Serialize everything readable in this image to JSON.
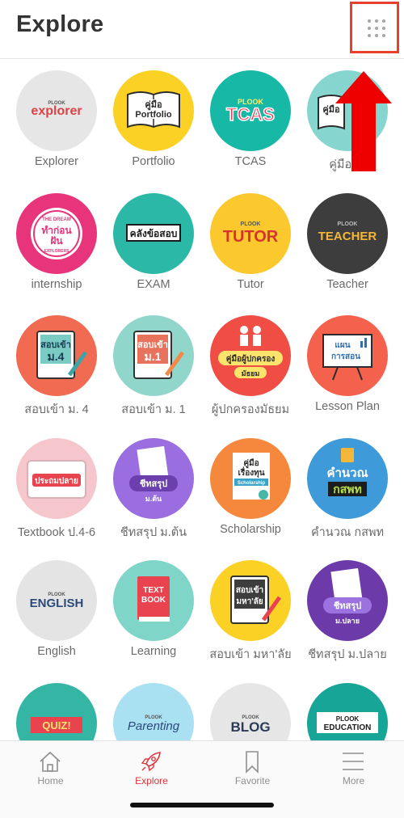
{
  "header": {
    "title": "Explore"
  },
  "items": [
    {
      "label": "Explorer",
      "color": "#e6e6e6",
      "logo": "PLOOK explorer"
    },
    {
      "label": "Portfolio",
      "color": "#fbd126",
      "logo": "คู่มือ Portfolio"
    },
    {
      "label": "TCAS",
      "color": "#17b8a6",
      "logo": "PLOOK TCAS"
    },
    {
      "label": "คู่มือ ม.",
      "color": "#86d6cf",
      "logo": "คู่มือ"
    },
    {
      "label": "internship",
      "color": "#e8347a",
      "logo": "THE DREAM ทำก่อนฝัน EXPLORERS"
    },
    {
      "label": "EXAM",
      "color": "#2bb8a6",
      "logo": "คลังข้อสอบ"
    },
    {
      "label": "Tutor",
      "color": "#fbc82e",
      "logo": "PLOOK TUTOR"
    },
    {
      "label": "Teacher",
      "color": "#3d3d3d",
      "logo": "PLOOK TEACHER"
    },
    {
      "label": "สอบเข้า ม. 4",
      "color": "#f16a52",
      "logo": "สอบเข้า ม.4"
    },
    {
      "label": "สอบเข้า ม. 1",
      "color": "#90d6cb",
      "logo": "สอบเข้า ม.1"
    },
    {
      "label": "ผู้ปกครองมัธยม",
      "color": "#f04e45",
      "logo": "คู่มือผู้ปกครอง มัธยม"
    },
    {
      "label": "Lesson Plan",
      "color": "#f4624e",
      "logo": "แผนการสอน"
    },
    {
      "label": "Textbook ป.4-6",
      "color": "#f5c7cc",
      "logo": "ประถมปลาย"
    },
    {
      "label": "ชีทสรุป ม.ต้น",
      "color": "#9a6ee0",
      "logo": "ชีทสรุป ม.ต้น"
    },
    {
      "label": "Scholarship",
      "color": "#f6883d",
      "logo": "คู่มือเรื่องทุน Scholarship"
    },
    {
      "label": "คำนวณ กสพท",
      "color": "#3e9ad8",
      "logo": "คำนวณ กสพท"
    },
    {
      "label": "English",
      "color": "#e4e4e4",
      "logo": "PLOOK ENGLISH"
    },
    {
      "label": "Learning",
      "color": "#7fd6c8",
      "logo": "TEXT BOOK"
    },
    {
      "label": "สอบเข้า มหา'ลัย",
      "color": "#fbd126",
      "logo": "สอบเข้า มหา'ลัย"
    },
    {
      "label": "ชีทสรุป ม.ปลาย",
      "color": "#6c3aa9",
      "logo": "ชีทสรุป ม.ปลาย"
    },
    {
      "label": "",
      "color": "#35b6a4",
      "logo": "QUIZ!"
    },
    {
      "label": "",
      "color": "#a9e1f2",
      "logo": "PLOOK Parenting"
    },
    {
      "label": "",
      "color": "#e6e6e6",
      "logo": "PLOOK BLOG"
    },
    {
      "label": "",
      "color": "#16a597",
      "logo": "PLOOK EDUCATION"
    }
  ],
  "tabs": [
    {
      "label": "Home",
      "icon": "home-icon"
    },
    {
      "label": "Explore",
      "icon": "rocket-icon",
      "active": true
    },
    {
      "label": "Favorite",
      "icon": "bookmark-icon"
    },
    {
      "label": "More",
      "icon": "hamburger-icon"
    }
  ],
  "colors": {
    "accent": "#e0353b",
    "annotation": "#e8402c",
    "arrow": "#ee0000"
  }
}
